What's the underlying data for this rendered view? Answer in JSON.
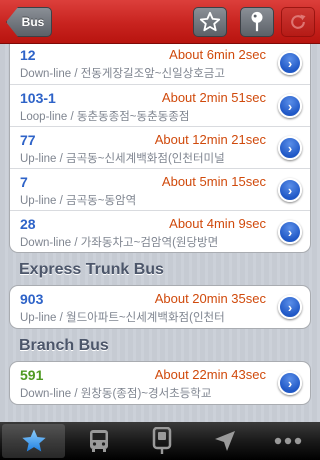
{
  "navbar": {
    "back_label": "Bus",
    "favorite_icon": "star-icon",
    "pin_icon": "pin-icon",
    "refresh_icon": "refresh-icon"
  },
  "sections": [
    {
      "header": "",
      "routes": [
        {
          "number": "12",
          "eta": "About 6min 2sec",
          "direction": "Down-line / 전동게장길조앞~신일상호금고"
        },
        {
          "number": "103-1",
          "eta": "About 2min 51sec",
          "direction": "Loop-line / 동춘동종점~동춘동종점"
        },
        {
          "number": "77",
          "eta": "About 12min 21sec",
          "direction": "Up-line / 금곡동~신세계백화점(인천터미널"
        },
        {
          "number": "7",
          "eta": "About 5min 15sec",
          "direction": "Up-line / 금곡동~동암역"
        },
        {
          "number": "28",
          "eta": "About 4min 9sec",
          "direction": "Down-line / 가좌동차고~검암역(원당방면"
        }
      ]
    },
    {
      "header": "Express Trunk Bus",
      "routes": [
        {
          "number": "903",
          "eta": "About 20min 35sec",
          "direction": "Up-line / 월드아파트~신세계백화점(인천터"
        }
      ]
    },
    {
      "header": "Branch Bus",
      "routes": [
        {
          "number": "591",
          "eta": "About 22min 43sec",
          "direction": "Down-line / 원창동(종점)~경서초등학교"
        }
      ]
    }
  ],
  "tabbar": {
    "tabs": [
      "star-icon",
      "bus-icon",
      "bus-stop-icon",
      "location-arrow-icon",
      "more-icon"
    ]
  },
  "colors": {
    "nav_red": "#c8231f",
    "route_blue": "#2e63c8",
    "route_green": "#4f9a22",
    "eta_orange": "#d04a0c"
  }
}
